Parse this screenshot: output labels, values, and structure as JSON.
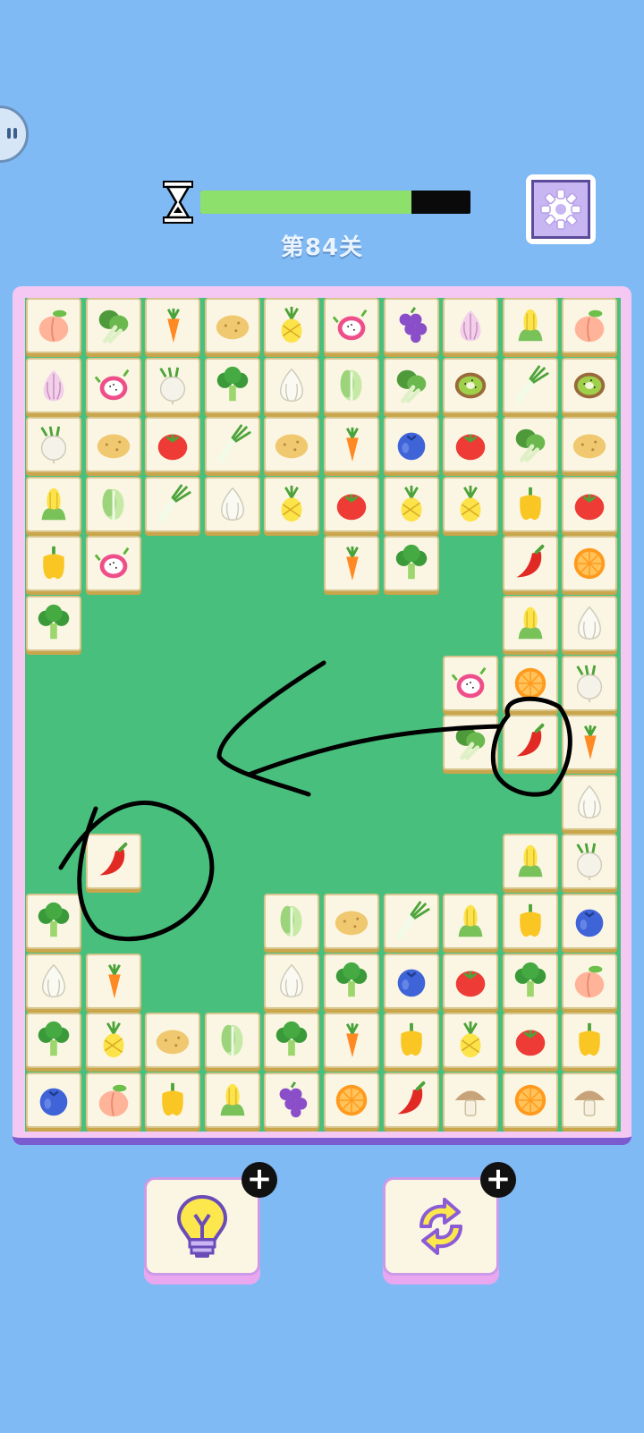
{
  "game": {
    "title": "第84关",
    "timer_fraction": 0.78
  },
  "colors": {
    "background": "#7fbaf5",
    "board": "#49bf7d",
    "timer_fill": "#8ee06c",
    "timer_empty": "#0a0a0a",
    "annotation": "#000000"
  },
  "board": {
    "columns": 10,
    "rows": [
      [
        "peach",
        "bok-choy",
        "carrot",
        "potato",
        "pineapple",
        "dragon-fruit",
        "grapes",
        "onion",
        "corn",
        "peach"
      ],
      [
        "onion",
        "dragon-fruit",
        "turnip",
        "broccoli",
        "garlic",
        "napa-cabbage",
        "bok-choy",
        "kiwi",
        "scallion",
        "kiwi"
      ],
      [
        "turnip",
        "potato",
        "tomato",
        "scallion",
        "potato",
        "carrot",
        "blueberry",
        "tomato",
        "bok-choy",
        "potato"
      ],
      [
        "corn",
        "napa-cabbage",
        "scallion",
        "garlic",
        "pineapple",
        "tomato",
        "pineapple",
        "pineapple",
        "bell-pepper",
        "tomato"
      ],
      [
        "bell-pepper",
        "dragon-fruit",
        "",
        "",
        "",
        "carrot",
        "broccoli",
        "",
        "chili-pepper",
        "orange"
      ],
      [
        "broccoli",
        "",
        "",
        "",
        "",
        "",
        "",
        "",
        "corn",
        "garlic"
      ],
      [
        "",
        "",
        "",
        "",
        "",
        "",
        "",
        "dragon-fruit",
        "orange",
        "turnip"
      ],
      [
        "",
        "",
        "",
        "",
        "",
        "",
        "",
        "bok-choy",
        "chili-pepper",
        "carrot"
      ],
      [
        "",
        "",
        "",
        "",
        "",
        "",
        "",
        "",
        "",
        "garlic"
      ],
      [
        "",
        "chili-pepper",
        "",
        "",
        "",
        "",
        "",
        "",
        "corn",
        "turnip"
      ],
      [
        "broccoli",
        "",
        "",
        "",
        "napa-cabbage",
        "potato",
        "scallion",
        "corn",
        "bell-pepper",
        "blueberry"
      ],
      [
        "garlic",
        "carrot",
        "",
        "",
        "garlic",
        "broccoli",
        "blueberry",
        "tomato",
        "broccoli",
        "peach"
      ],
      [
        "broccoli",
        "pineapple",
        "potato",
        "napa-cabbage",
        "broccoli",
        "carrot",
        "bell-pepper",
        "pineapple",
        "tomato",
        "bell-pepper"
      ],
      [
        "blueberry",
        "peach",
        "bell-pepper",
        "corn",
        "grapes",
        "orange",
        "chili-pepper",
        "mushroom",
        "orange",
        "mushroom"
      ]
    ]
  },
  "buttons": {
    "hint_icon": "lightbulb-icon",
    "shuffle_icon": "refresh-icon",
    "plus": "+"
  },
  "annotations": {
    "circle_1": "circle-around-chili-pepper-right",
    "circle_2": "circle-around-chili-pepper-left",
    "arrow": "arrow-pointing-left"
  }
}
